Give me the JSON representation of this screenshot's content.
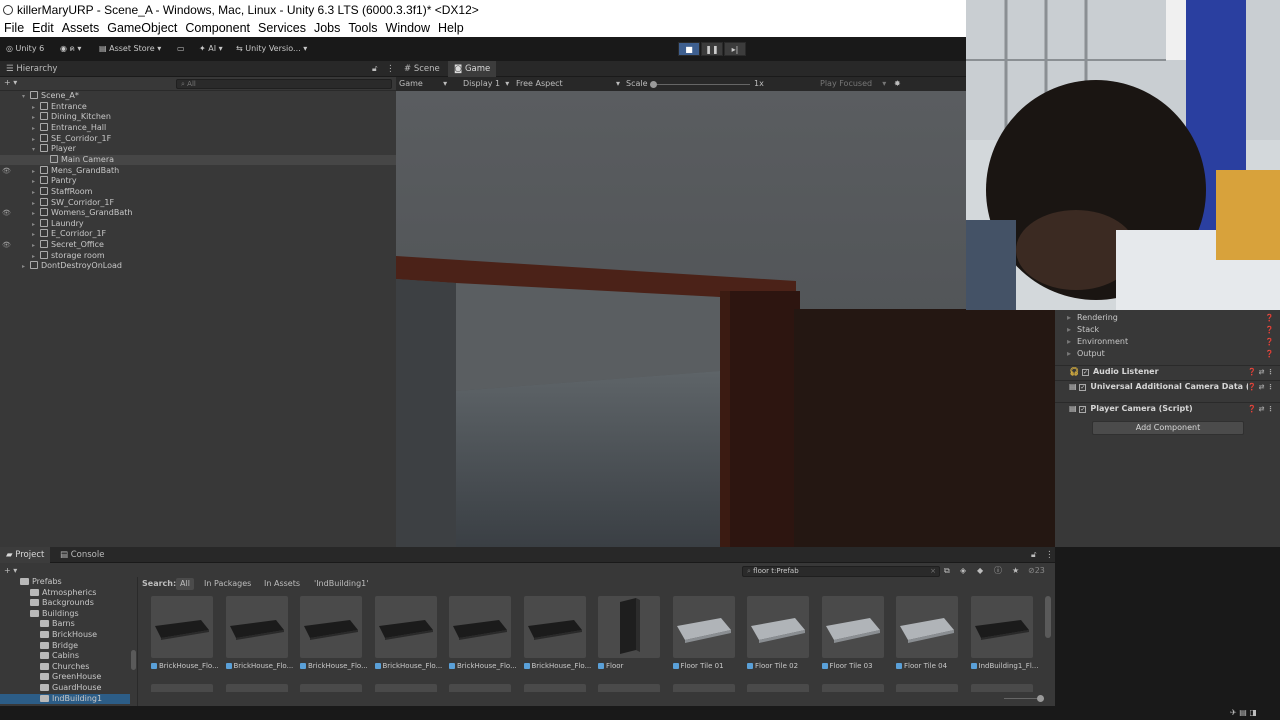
{
  "window": {
    "title": "killerMaryURP - Scene_A - Windows, Mac, Linux - Unity 6.3 LTS (6000.3.3f1)* <DX12>"
  },
  "menu": [
    "File",
    "Edit",
    "Assets",
    "GameObject",
    "Component",
    "Services",
    "Jobs",
    "Tools",
    "Window",
    "Help"
  ],
  "toolbar": {
    "unity_label": "Unity 6",
    "account": "ค",
    "asset_store": "Asset Store",
    "ai": "AI",
    "version_control": "Unity Versio..."
  },
  "hierarchy": {
    "tab": "Hierarchy",
    "search_placeholder": "All",
    "scene": "Scene_A*",
    "items": [
      {
        "label": "Entrance",
        "selected": false,
        "eye": false
      },
      {
        "label": "Dining_Kitchen",
        "selected": false,
        "eye": false
      },
      {
        "label": "Entrance_Hall",
        "selected": false,
        "eye": false
      },
      {
        "label": "SE_Corridor_1F",
        "selected": false,
        "eye": false
      },
      {
        "label": "Player",
        "selected": false,
        "eye": false
      },
      {
        "label": "Main Camera",
        "selected": true,
        "eye": false
      },
      {
        "label": "Mens_GrandBath",
        "selected": false,
        "eye": true
      },
      {
        "label": "Pantry",
        "selected": false,
        "eye": false
      },
      {
        "label": "StaffRoom",
        "selected": false,
        "eye": false
      },
      {
        "label": "SW_Corridor_1F",
        "selected": false,
        "eye": false
      },
      {
        "label": "Womens_GrandBath",
        "selected": false,
        "eye": true
      },
      {
        "label": "Laundry",
        "selected": false,
        "eye": false
      },
      {
        "label": "E_Corridor_1F",
        "selected": false,
        "eye": false
      },
      {
        "label": "Secret_Office",
        "selected": false,
        "eye": true
      },
      {
        "label": "storage room",
        "selected": false,
        "eye": false
      }
    ],
    "dont_destroy": "DontDestroyOnLoad"
  },
  "game_view": {
    "tabs": [
      "Scene",
      "Game"
    ],
    "mode": "Game",
    "display": "Display 1",
    "aspect": "Free Aspect",
    "scale_label": "Scale",
    "scale_value": "1x",
    "play_focused": "Play Focused"
  },
  "inspector": {
    "rows": [
      "Rendering",
      "Stack",
      "Environment",
      "Output"
    ],
    "components": [
      {
        "label": "Audio Listener"
      },
      {
        "label": "Universal Additional Camera Data (Sc"
      },
      {
        "label": "Player Camera (Script)"
      }
    ],
    "add_component": "Add Component"
  },
  "project": {
    "tabs": [
      "Project",
      "Console"
    ],
    "search_value": "floor t:Prefab",
    "count": "23",
    "search_label": "Search:",
    "filters": [
      "All",
      "In Packages",
      "In Assets",
      "'IndBuilding1'"
    ],
    "tree": [
      {
        "label": "Prefabs",
        "indent": 1,
        "selected": false
      },
      {
        "label": "Atmospherics",
        "indent": 2,
        "selected": false
      },
      {
        "label": "Backgrounds",
        "indent": 2,
        "selected": false
      },
      {
        "label": "Buildings",
        "indent": 2,
        "selected": false
      },
      {
        "label": "Barns",
        "indent": 3,
        "selected": false
      },
      {
        "label": "BrickHouse",
        "indent": 3,
        "selected": false
      },
      {
        "label": "Bridge",
        "indent": 3,
        "selected": false
      },
      {
        "label": "Cabins",
        "indent": 3,
        "selected": false
      },
      {
        "label": "Churches",
        "indent": 3,
        "selected": false
      },
      {
        "label": "GreenHouse",
        "indent": 3,
        "selected": false
      },
      {
        "label": "GuardHouse",
        "indent": 3,
        "selected": false
      },
      {
        "label": "IndBuilding1",
        "indent": 3,
        "selected": true
      }
    ],
    "assets": [
      {
        "label": "BrickHouse_Flo...",
        "kind": "slab"
      },
      {
        "label": "BrickHouse_Flo...",
        "kind": "slab"
      },
      {
        "label": "BrickHouse_Flo...",
        "kind": "slab"
      },
      {
        "label": "BrickHouse_Flo...",
        "kind": "slab"
      },
      {
        "label": "BrickHouse_Flo...",
        "kind": "slab"
      },
      {
        "label": "BrickHouse_Flo...",
        "kind": "slab"
      },
      {
        "label": "Floor",
        "kind": "door"
      },
      {
        "label": "Floor Tile 01",
        "kind": "tile"
      },
      {
        "label": "Floor Tile 02",
        "kind": "tile"
      },
      {
        "label": "Floor Tile 03",
        "kind": "tile"
      },
      {
        "label": "Floor Tile 04",
        "kind": "tile"
      },
      {
        "label": "IndBuilding1_Fl...",
        "kind": "slab"
      }
    ]
  },
  "colors": {
    "accent": "#3e5f8f",
    "selection": "#2c5d87",
    "panel": "#383838"
  }
}
